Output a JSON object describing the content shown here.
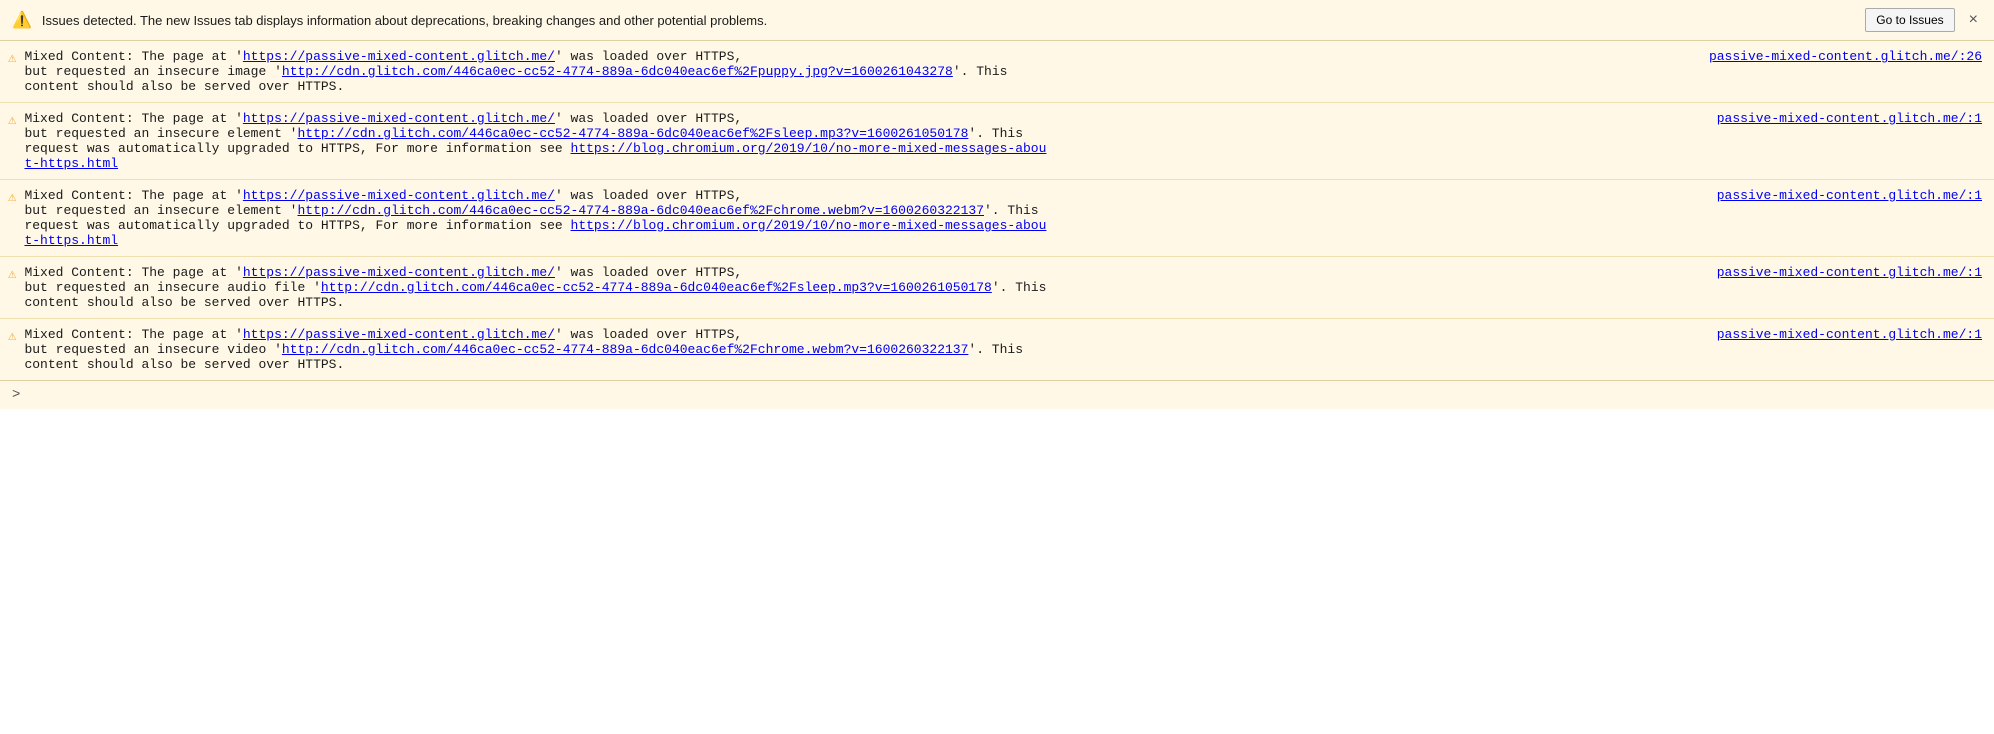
{
  "banner": {
    "icon": "⚠",
    "text": "Issues detected. The new Issues tab displays information about deprecations, breaking changes and other potential problems.",
    "button_label": "Go to Issues",
    "close_label": "×"
  },
  "entries": [
    {
      "id": 1,
      "icon": "⚠",
      "text_before": "Mixed Content: The page at '",
      "page_url": "https://passive-mixed-content.glitch.me/",
      "text_middle": "' was loaded over HTTPS, but requested an insecure image '",
      "resource_url": "http://cdn.glitch.com/446ca0ec-cc52-4774-889a-6dc040eac6ef%2Fpuppy.jpg?v=1600261043278",
      "text_after": "'. This content should also be served over HTTPS.",
      "source_link_text": "passive-mixed-content.glitch.me/:26",
      "source_link_url": "https://passive-mixed-content.glitch.me/:26",
      "extra_lines": []
    },
    {
      "id": 2,
      "icon": "⚠",
      "text_before": "Mixed Content: The page at '",
      "page_url": "https://passive-mixed-content.glitch.me/",
      "text_middle": "' was loaded over HTTPS, but requested an insecure element '",
      "resource_url": "http://cdn.glitch.com/446ca0ec-cc52-4774-889a-6dc040eac6ef%2Fsleep.mp3?v=1600261050178",
      "text_after": "'. This request was automatically upgraded to HTTPS, For more information see ",
      "extra_link_url": "https://blog.chromium.org/2019/10/no-more-mixed-messages-about-https.html",
      "extra_link_text": "https://blog.chromium.org/2019/10/no-more-mixed-messages-about-https.html",
      "source_link_text": "passive-mixed-content.glitch.me/:1",
      "source_link_url": "https://passive-mixed-content.glitch.me/:1",
      "has_extra_link": true
    },
    {
      "id": 3,
      "icon": "⚠",
      "text_before": "Mixed Content: The page at '",
      "page_url": "https://passive-mixed-content.glitch.me/",
      "text_middle": "' was loaded over HTTPS, but requested an insecure element '",
      "resource_url": "http://cdn.glitch.com/446ca0ec-cc52-4774-889a-6dc040eac6ef%2Fchrome.webm?v=1600260322137",
      "text_after": "'. This request was automatically upgraded to HTTPS, For more information see ",
      "extra_link_url": "https://blog.chromium.org/2019/10/no-more-mixed-messages-about-https.html",
      "extra_link_text": "https://blog.chromium.org/2019/10/no-more-mixed-messages-about-https.html",
      "source_link_text": "passive-mixed-content.glitch.me/:1",
      "source_link_url": "https://passive-mixed-content.glitch.me/:1",
      "has_extra_link": true
    },
    {
      "id": 4,
      "icon": "⚠",
      "text_before": "Mixed Content: The page at '",
      "page_url": "https://passive-mixed-content.glitch.me/",
      "text_middle": "' was loaded over HTTPS, but requested an insecure audio file '",
      "resource_url": "http://cdn.glitch.com/446ca0ec-cc52-4774-889a-6dc040eac6ef%2Fsleep.mp3?v=1600261050178",
      "text_after": "'. This content should also be served over HTTPS.",
      "source_link_text": "passive-mixed-content.glitch.me/:1",
      "source_link_url": "https://passive-mixed-content.glitch.me/:1",
      "has_extra_link": false
    },
    {
      "id": 5,
      "icon": "⚠",
      "text_before": "Mixed Content: The page at '",
      "page_url": "https://passive-mixed-content.glitch.me/",
      "text_middle": "' was loaded over HTTPS, but requested an insecure video '",
      "resource_url": "http://cdn.glitch.com/446ca0ec-cc52-4774-889a-6dc040eac6ef%2Fchrome.webm?v=1600260322137",
      "text_after": "'. This content should also be served over HTTPS.",
      "source_link_text": "passive-mixed-content.glitch.me/:1",
      "source_link_url": "https://passive-mixed-content.glitch.me/:1",
      "has_extra_link": false
    }
  ],
  "footer": {
    "chevron": ">"
  }
}
